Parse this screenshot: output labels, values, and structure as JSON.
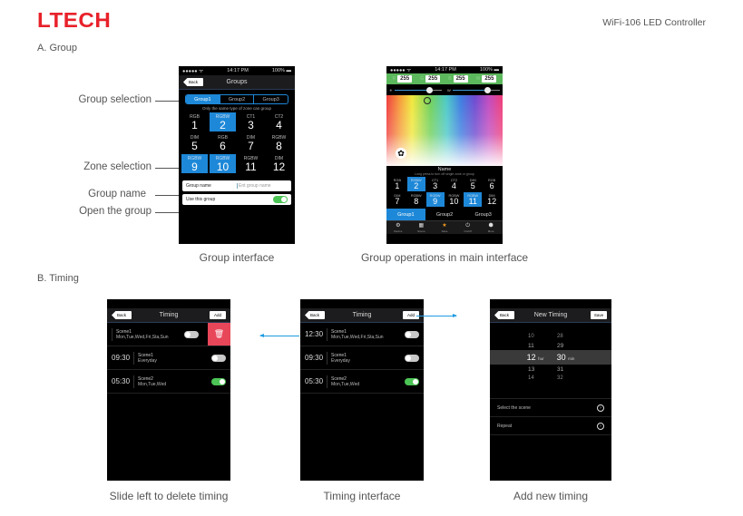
{
  "header": {
    "logo": "LTECH",
    "doc_title": "WiFi-106 LED Controller"
  },
  "sections": {
    "group": "A. Group",
    "timing": "B. Timing"
  },
  "callouts": {
    "group_selection": "Group selection",
    "zone_selection": "Zone selection",
    "group_name": "Group name",
    "open_group": "Open the group"
  },
  "captions": {
    "group_interface": "Group interface",
    "group_operations": "Group operations in main interface",
    "slide_delete": "Slide left to delete timing",
    "timing_interface": "Timing interface",
    "add_new_timing": "Add new timing"
  },
  "status_bar": {
    "signal": "●●●●● ᯤ",
    "time": "14:17 PM",
    "battery": "100% ▬"
  },
  "group_screen": {
    "back": "Back",
    "title": "Groups",
    "tabs": [
      {
        "label": "Group1",
        "active": true
      },
      {
        "label": "Group2",
        "active": false
      },
      {
        "label": "Group3",
        "active": false
      }
    ],
    "hint": "Only the same type of zone can group",
    "zones": [
      {
        "type": "RGB",
        "num": "1",
        "selected": false
      },
      {
        "type": "RGBW",
        "num": "2",
        "selected": true
      },
      {
        "type": "CT1",
        "num": "3",
        "selected": false
      },
      {
        "type": "CT2",
        "num": "4",
        "selected": false
      },
      {
        "type": "DIM",
        "num": "5",
        "selected": false
      },
      {
        "type": "RGB",
        "num": "6",
        "selected": false
      },
      {
        "type": "DIM",
        "num": "7",
        "selected": false
      },
      {
        "type": "RGBW",
        "num": "8",
        "selected": false
      },
      {
        "type": "RGBW",
        "num": "9",
        "selected": true
      },
      {
        "type": "RGBW",
        "num": "10",
        "selected": true
      },
      {
        "type": "RGBW",
        "num": "11",
        "selected": false
      },
      {
        "type": "DIM",
        "num": "12",
        "selected": false
      }
    ],
    "group_name_label": "Group name",
    "group_name_placeholder": "Ent group name",
    "use_group_label": "Use this group",
    "use_group_on": true
  },
  "main_screen": {
    "channels": [
      {
        "name": "R",
        "value": "255"
      },
      {
        "name": "G",
        "value": "255"
      },
      {
        "name": "B",
        "value": "255"
      },
      {
        "name": "W",
        "value": "255"
      }
    ],
    "brightness": {
      "label": "☀",
      "pct": "80%"
    },
    "white": {
      "label": "W",
      "pct": "80%"
    },
    "name": "Name",
    "name_sub": "Long press to turn off single zone or group",
    "zones": [
      {
        "type": "RGB",
        "num": "1",
        "selected": false
      },
      {
        "type": "RGBW",
        "num": "2",
        "selected": true
      },
      {
        "type": "CT1",
        "num": "3",
        "selected": false
      },
      {
        "type": "CT2",
        "num": "4",
        "selected": false
      },
      {
        "type": "DIM",
        "num": "5",
        "selected": false
      },
      {
        "type": "RGB",
        "num": "6",
        "selected": false
      },
      {
        "type": "DIM",
        "num": "7",
        "selected": false
      },
      {
        "type": "RGBW",
        "num": "8",
        "selected": false
      },
      {
        "type": "RGBW",
        "num": "9",
        "selected": true
      },
      {
        "type": "RGBW",
        "num": "10",
        "selected": false
      },
      {
        "type": "RGBW",
        "num": "11",
        "selected": true
      },
      {
        "type": "DIM",
        "num": "12",
        "selected": false
      }
    ],
    "group_tabs": [
      {
        "label": "Group1",
        "active": true
      },
      {
        "label": "Group2",
        "active": false
      },
      {
        "label": "Group3",
        "active": false
      }
    ],
    "nav": [
      {
        "icon": "device-icon",
        "glyph": "⚙",
        "label": "Device"
      },
      {
        "icon": "scene-icon",
        "glyph": "▦",
        "label": "Scene"
      },
      {
        "icon": "save-star-icon",
        "glyph": "★",
        "label": "Save"
      },
      {
        "icon": "onoff-icon",
        "glyph": "⏻",
        "label": "On/off"
      },
      {
        "icon": "more-icon",
        "glyph": "⬢",
        "label": "More"
      }
    ]
  },
  "timing_delete_screen": {
    "back": "Back",
    "title": "Timing",
    "add": "Add",
    "rows": [
      {
        "time": "",
        "scene": "Scene1",
        "days": "Mon,Tue,Wed,Fri,Sta,Sun",
        "on": false,
        "deleting": true
      },
      {
        "time": "09:30",
        "scene": "Scene1",
        "days": "Everyday",
        "on": false,
        "deleting": false
      },
      {
        "time": "05:30",
        "scene": "Scene2",
        "days": "Mon,Tue,Wed",
        "on": true,
        "deleting": false
      }
    ],
    "delete_icon": "🗑"
  },
  "timing_screen": {
    "back": "Back",
    "title": "Timing",
    "add": "Add",
    "rows": [
      {
        "time": "12:30",
        "scene": "Scene1",
        "days": "Mon,Tue,Wed,Fri,Sta,Sun",
        "on": false
      },
      {
        "time": "09:30",
        "scene": "Scene1",
        "days": "Everyday",
        "on": false
      },
      {
        "time": "05:30",
        "scene": "Scene2",
        "days": "Mon,Tue,Wed",
        "on": true
      }
    ]
  },
  "new_timing_screen": {
    "back": "Back",
    "title": "New Timing",
    "save": "Save",
    "hours": [
      "10",
      "11",
      "12",
      "13",
      "14"
    ],
    "minutes": [
      "28",
      "29",
      "30",
      "31",
      "32"
    ],
    "hour_unit": "hur",
    "min_unit": "min",
    "options": [
      {
        "label": "Select the scene"
      },
      {
        "label": "Repeat"
      }
    ]
  }
}
